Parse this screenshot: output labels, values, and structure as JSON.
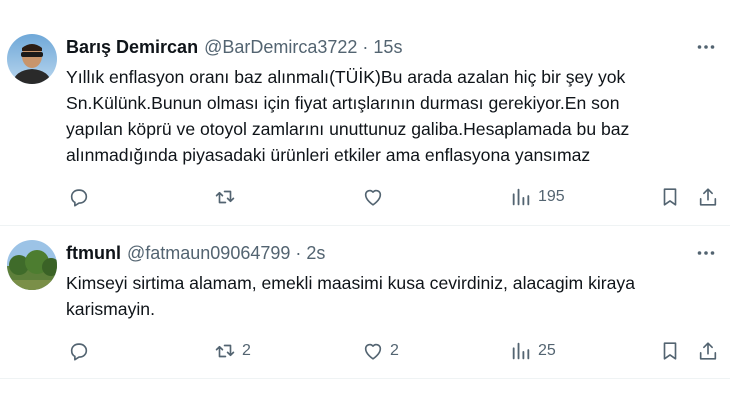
{
  "tweets": [
    {
      "author": "Barış Demircan",
      "handle": "@BarDemirca3722",
      "separator": "·",
      "time": "15s",
      "text_lines": [
        "Yıllık enflasyon oranı baz alınmalı(TÜİK)Bu arada azalan hiç bir şey yok",
        "Sn.Külünk.Bunun olması için fiyat artışlarının durması gerekiyor.En son",
        "yapılan köprü ve otoyol zamlarını unuttunuz galiba.Hesaplamada bu baz",
        "alınmadığında piyasadaki ürünleri etkiler ama enflasyona yansımaz"
      ],
      "replies": "",
      "retweets": "",
      "likes": "",
      "views": "195"
    },
    {
      "author": "ftmunl",
      "handle": "@fatmaun09064799",
      "separator": "·",
      "time": "2s",
      "text_lines": [
        "Kimseyi sirtima alamam, emekli maasimi kusa cevirdiniz, alacagim kiraya",
        "karismayin."
      ],
      "replies": "",
      "retweets": "2",
      "likes": "2",
      "views": "25"
    }
  ],
  "colors": {
    "text": "#0f1419",
    "secondary": "#536471",
    "divider": "#eff3f4"
  },
  "icons": [
    "more-icon",
    "reply-icon",
    "retweet-icon",
    "like-icon",
    "views-icon",
    "bookmark-icon",
    "share-icon"
  ]
}
